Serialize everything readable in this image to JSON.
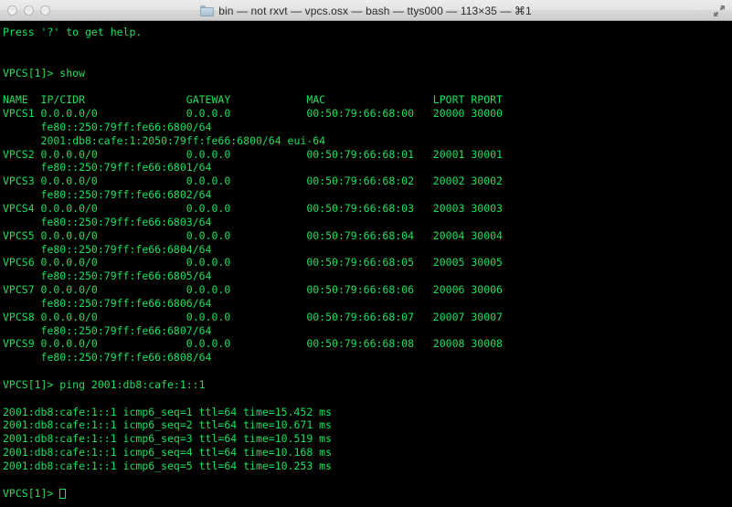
{
  "window": {
    "title": "bin — not rxvt — vpcs.osx — bash — ttys000 — 113×35 — ⌘1",
    "folder_icon": "folder-icon",
    "expand_icon": "expand-arrows-icon",
    "traffic_lights": [
      "close-button",
      "minimize-button",
      "zoom-button"
    ],
    "colors": {
      "terminal_background": "#000000",
      "terminal_foreground": "#1ee05a",
      "titlebar_background": "#e4e4e4",
      "titlebar_text": "#2b2b2b"
    }
  },
  "terminal": {
    "columns": 113,
    "rows": 35,
    "prompt": "VPCS[1]> ",
    "help_line": "Press '?' to get help.",
    "commands": {
      "show": "show",
      "ping": "ping 2001:db8:cafe:1::1"
    },
    "table": {
      "headers": [
        "NAME",
        "IP/CIDR",
        "GATEWAY",
        "MAC",
        "LPORT",
        "RPORT"
      ],
      "column_starts": [
        0,
        6,
        29,
        48,
        68,
        74
      ],
      "rows": [
        {
          "name": "VPCS1",
          "ip_cidr": "0.0.0.0/0",
          "gateway": "0.0.0.0",
          "mac": "00:50:79:66:68:00",
          "lport": "20000",
          "rport": "30000",
          "extra": [
            "fe80::250:79ff:fe66:6800/64",
            "2001:db8:cafe:1:2050:79ff:fe66:6800/64 eui-64"
          ]
        },
        {
          "name": "VPCS2",
          "ip_cidr": "0.0.0.0/0",
          "gateway": "0.0.0.0",
          "mac": "00:50:79:66:68:01",
          "lport": "20001",
          "rport": "30001",
          "extra": [
            "fe80::250:79ff:fe66:6801/64"
          ]
        },
        {
          "name": "VPCS3",
          "ip_cidr": "0.0.0.0/0",
          "gateway": "0.0.0.0",
          "mac": "00:50:79:66:68:02",
          "lport": "20002",
          "rport": "30002",
          "extra": [
            "fe80::250:79ff:fe66:6802/64"
          ]
        },
        {
          "name": "VPCS4",
          "ip_cidr": "0.0.0.0/0",
          "gateway": "0.0.0.0",
          "mac": "00:50:79:66:68:03",
          "lport": "20003",
          "rport": "30003",
          "extra": [
            "fe80::250:79ff:fe66:6803/64"
          ]
        },
        {
          "name": "VPCS5",
          "ip_cidr": "0.0.0.0/0",
          "gateway": "0.0.0.0",
          "mac": "00:50:79:66:68:04",
          "lport": "20004",
          "rport": "30004",
          "extra": [
            "fe80::250:79ff:fe66:6804/64"
          ]
        },
        {
          "name": "VPCS6",
          "ip_cidr": "0.0.0.0/0",
          "gateway": "0.0.0.0",
          "mac": "00:50:79:66:68:05",
          "lport": "20005",
          "rport": "30005",
          "extra": [
            "fe80::250:79ff:fe66:6805/64"
          ]
        },
        {
          "name": "VPCS7",
          "ip_cidr": "0.0.0.0/0",
          "gateway": "0.0.0.0",
          "mac": "00:50:79:66:68:06",
          "lport": "20006",
          "rport": "30006",
          "extra": [
            "fe80::250:79ff:fe66:6806/64"
          ]
        },
        {
          "name": "VPCS8",
          "ip_cidr": "0.0.0.0/0",
          "gateway": "0.0.0.0",
          "mac": "00:50:79:66:68:07",
          "lport": "20007",
          "rport": "30007",
          "extra": [
            "fe80::250:79ff:fe66:6807/64"
          ]
        },
        {
          "name": "VPCS9",
          "ip_cidr": "0.0.0.0/0",
          "gateway": "0.0.0.0",
          "mac": "00:50:79:66:68:08",
          "lport": "20008",
          "rport": "30008",
          "extra": [
            "fe80::250:79ff:fe66:6808/64"
          ]
        }
      ]
    },
    "ping_results": [
      "2001:db8:cafe:1::1 icmp6_seq=1 ttl=64 time=15.452 ms",
      "2001:db8:cafe:1::1 icmp6_seq=2 ttl=64 time=10.671 ms",
      "2001:db8:cafe:1::1 icmp6_seq=3 ttl=64 time=10.519 ms",
      "2001:db8:cafe:1::1 icmp6_seq=4 ttl=64 time=10.168 ms",
      "2001:db8:cafe:1::1 icmp6_seq=5 ttl=64 time=10.253 ms"
    ]
  }
}
